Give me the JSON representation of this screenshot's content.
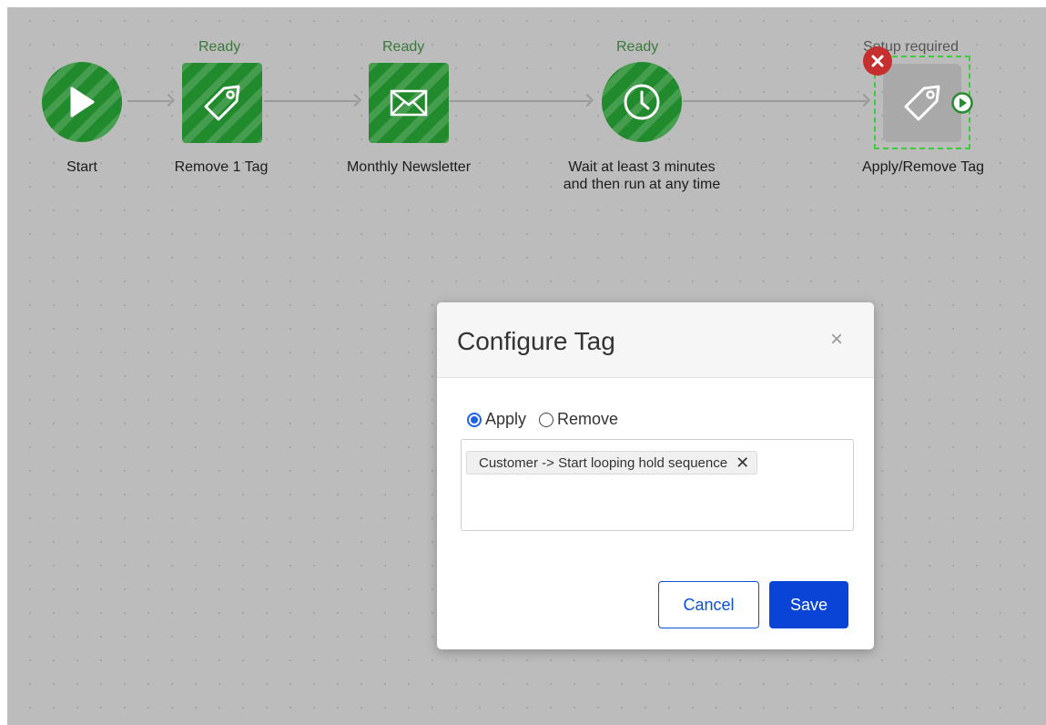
{
  "workflow": {
    "nodes": [
      {
        "id": "start",
        "status": "",
        "label": "Start",
        "icon": "play-icon"
      },
      {
        "id": "remove-tag",
        "status": "Ready",
        "label": "Remove 1 Tag",
        "icon": "tag-icon"
      },
      {
        "id": "newsletter",
        "status": "Ready",
        "label": "Monthly Newsletter",
        "icon": "envelope-icon"
      },
      {
        "id": "wait",
        "status": "Ready",
        "label_line1": "Wait at least 3 minutes",
        "label_line2": "and then run at any time",
        "icon": "clock-icon"
      },
      {
        "id": "apply-remove-tag",
        "status": "Setup required",
        "label": "Apply/Remove Tag",
        "icon": "tag-icon"
      }
    ],
    "colors": {
      "node_green": "#218a2c",
      "status_green": "#3a7a3a",
      "canvas": "#bcbcbc"
    }
  },
  "modal": {
    "title": "Configure Tag",
    "close_symbol": "×",
    "options": {
      "apply_label": "Apply",
      "remove_label": "Remove",
      "selected": "Apply"
    },
    "tags": [
      {
        "label": "Customer -> Start looping hold sequence",
        "remove_symbol": "✕"
      }
    ],
    "cancel_label": "Cancel",
    "save_label": "Save",
    "colors": {
      "primary": "#0a44d6"
    }
  }
}
